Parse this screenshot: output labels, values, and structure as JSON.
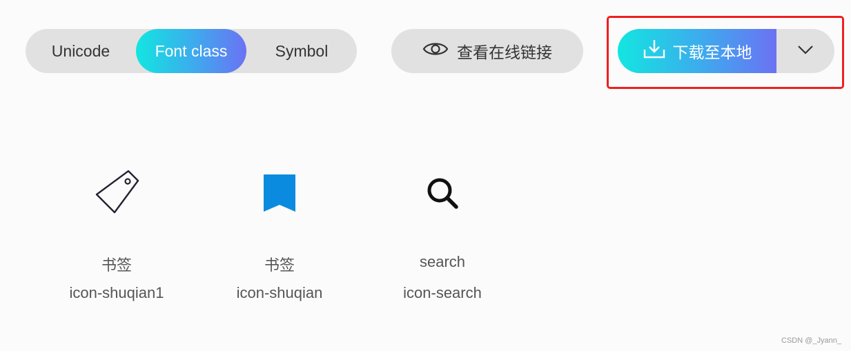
{
  "toolbar": {
    "tabs": [
      {
        "label": "Unicode",
        "active": false
      },
      {
        "label": "Font class",
        "active": true
      },
      {
        "label": "Symbol",
        "active": false
      }
    ],
    "view_link_label": "查看在线链接",
    "download_label": "下载至本地",
    "accent_gradient": [
      "#12e6e0",
      "#6b72f3"
    ],
    "highlight_color": "#f01e1e"
  },
  "icons": [
    {
      "icon": "tag-icon",
      "name": "书签",
      "code": "icon-shuqian1"
    },
    {
      "icon": "bookmark-icon",
      "name": "书签",
      "code": "icon-shuqian"
    },
    {
      "icon": "search-icon",
      "name": "search",
      "code": "icon-search"
    }
  ],
  "watermark": "CSDN @_Jyann_"
}
